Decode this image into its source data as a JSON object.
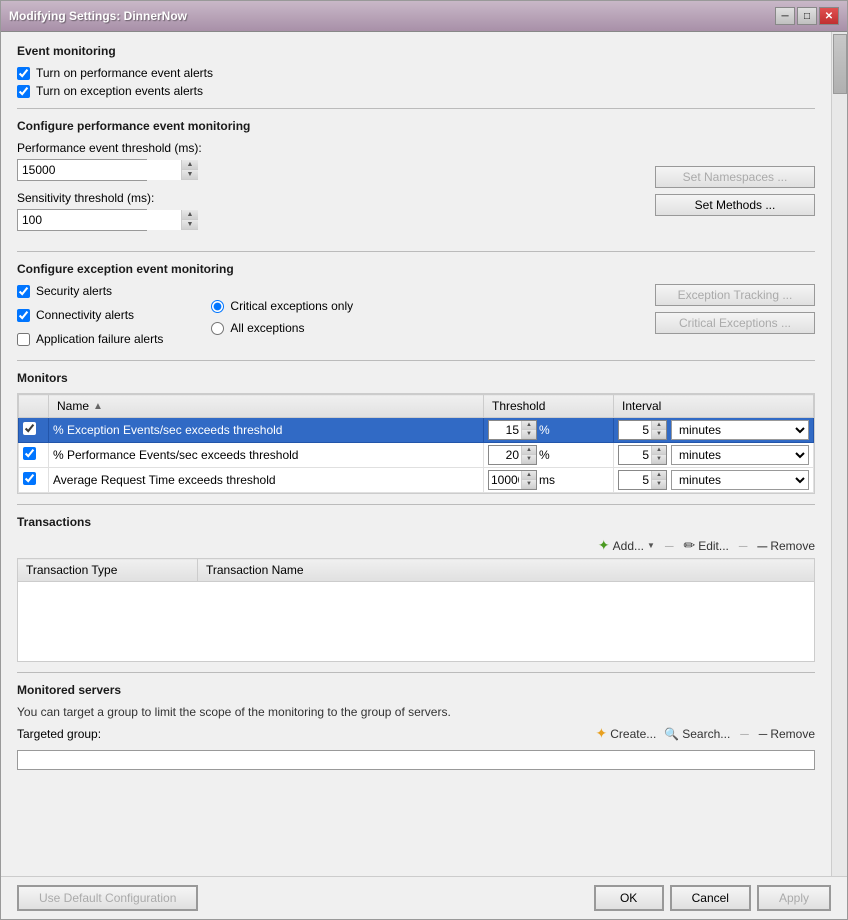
{
  "window": {
    "title": "Modifying Settings: DinnerNow"
  },
  "event_monitoring": {
    "section_title": "Event monitoring",
    "checkbox1_label": "Turn on performance event alerts",
    "checkbox2_label": "Turn on exception events alerts",
    "checkbox1_checked": true,
    "checkbox2_checked": true
  },
  "performance_monitoring": {
    "section_title": "Configure performance event monitoring",
    "perf_threshold_label": "Performance event threshold (ms):",
    "perf_threshold_value": "15000",
    "sensitivity_label": "Sensitivity threshold (ms):",
    "sensitivity_value": "100",
    "set_namespaces_label": "Set Namespaces ...",
    "set_methods_label": "Set Methods ..."
  },
  "exception_monitoring": {
    "section_title": "Configure exception event monitoring",
    "security_alerts_label": "Security alerts",
    "connectivity_alerts_label": "Connectivity alerts",
    "app_failure_label": "Application failure alerts",
    "security_checked": true,
    "connectivity_checked": true,
    "app_failure_checked": false,
    "critical_only_label": "Critical exceptions only",
    "all_exceptions_label": "All exceptions",
    "critical_only_selected": true,
    "exception_tracking_label": "Exception Tracking ...",
    "critical_exceptions_label": "Critical Exceptions ..."
  },
  "monitors": {
    "section_title": "Monitors",
    "columns": [
      "Name",
      "Threshold",
      "Interval"
    ],
    "rows": [
      {
        "checked": true,
        "name": "% Exception Events/sec exceeds threshold",
        "threshold": "15",
        "threshold_unit": "%",
        "interval": "5",
        "interval_unit": "minutes",
        "selected": true
      },
      {
        "checked": true,
        "name": "% Performance Events/sec exceeds threshold",
        "threshold": "20",
        "threshold_unit": "%",
        "interval": "5",
        "interval_unit": "minutes",
        "selected": false
      },
      {
        "checked": true,
        "name": "Average Request Time exceeds threshold",
        "threshold": "10000",
        "threshold_unit": "ms",
        "interval": "5",
        "interval_unit": "minutes",
        "selected": false
      }
    ]
  },
  "transactions": {
    "section_title": "Transactions",
    "add_label": "Add...",
    "edit_label": "Edit...",
    "remove_label": "Remove",
    "col_type": "Transaction Type",
    "col_name": "Transaction Name"
  },
  "monitored_servers": {
    "section_title": "Monitored servers",
    "description": "You can target a group to limit the scope of the monitoring to the group of servers.",
    "targeted_group_label": "Targeted group:",
    "create_label": "Create...",
    "search_label": "Search...",
    "remove_label": "Remove"
  },
  "footer": {
    "use_default_label": "Use Default Configuration",
    "ok_label": "OK",
    "cancel_label": "Cancel",
    "apply_label": "Apply"
  }
}
